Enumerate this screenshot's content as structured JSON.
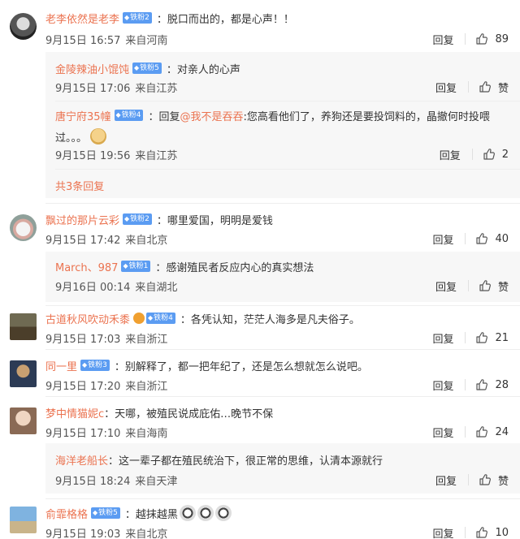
{
  "comments": [
    {
      "user": "老李依然是老李",
      "badge": "铁粉2",
      "text": "：脱口而出的，都是心声！！",
      "time": "9月15日 16:57",
      "location": "来自河南",
      "reply": "回复",
      "likes": "89"
    },
    {
      "user": "飘过的那片云彩",
      "badge": "铁粉2",
      "text": "：哪里爱国，明明是爱钱",
      "time": "9月15日 17:42",
      "location": "来自北京",
      "reply": "回复",
      "likes": "40"
    },
    {
      "user": "古道秋风吹动禾黍",
      "badge": "铁粉4",
      "text": "：各凭认知，茫茫人海多是凡夫俗子。",
      "time": "9月15日 17:03",
      "location": "来自浙江",
      "reply": "回复",
      "likes": "21"
    },
    {
      "user": "同一里",
      "badge": "铁粉3",
      "text": "：别解释了，都一把年纪了，还是怎么想就怎么说吧。",
      "time": "9月15日 17:20",
      "location": "来自浙江",
      "reply": "回复",
      "likes": "28"
    },
    {
      "user": "梦中情猫妮c",
      "text": "：天哪，被殖民说成庇佑…晚节不保",
      "time": "9月15日 17:10",
      "location": "来自海南",
      "reply": "回复",
      "likes": "24"
    },
    {
      "user": "俞霏格格",
      "badge": "铁粉5",
      "text": "：越抹越黑",
      "time": "9月15日 19:03",
      "location": "来自北京",
      "reply": "回复",
      "likes": "10"
    }
  ],
  "replies_group1": [
    {
      "user": "金陵辣油小馄饨",
      "badge": "铁粉5",
      "text": "：对亲人的心声",
      "time": "9月15日 17:06",
      "location": "来自江苏",
      "reply": "回复",
      "likes": "赞"
    },
    {
      "user": "唐宁府35幢",
      "badge": "铁粉4",
      "text_pre": "：回复",
      "mention": "@我不是吞吞",
      "text": ":您高看他们了，养狗还是要投饲料的，晶撤何时投喂",
      "text2": "过。。。",
      "time": "9月15日 19:56",
      "location": "来自江苏",
      "reply": "回复",
      "likes": "2"
    }
  ],
  "more_replies": "共3条回复",
  "reply_group2": {
    "user": "March、987",
    "badge": "铁粉1",
    "text": "：感谢殖民者反应内心的真实想法",
    "time": "9月16日 00:14",
    "location": "来自湖北",
    "reply": "回复",
    "likes": "赞"
  },
  "reply_group5": {
    "user": "海洋老船长",
    "text": "：这一辈子都在殖民统治下，很正常的思维，认清本源就行",
    "time": "9月15日 18:24",
    "location": "来自天津",
    "reply": "回复",
    "likes": "赞"
  }
}
